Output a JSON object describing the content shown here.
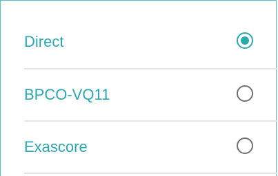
{
  "options": [
    {
      "label": "Direct",
      "selected": true
    },
    {
      "label": "BPCO-VQ11",
      "selected": false
    },
    {
      "label": "Exascore",
      "selected": false
    }
  ],
  "colors": {
    "accent": "#2aa8b0",
    "border": "#4cc3c6",
    "divider": "#e5e5e5",
    "radio_unselected": "#6f6f6f"
  }
}
